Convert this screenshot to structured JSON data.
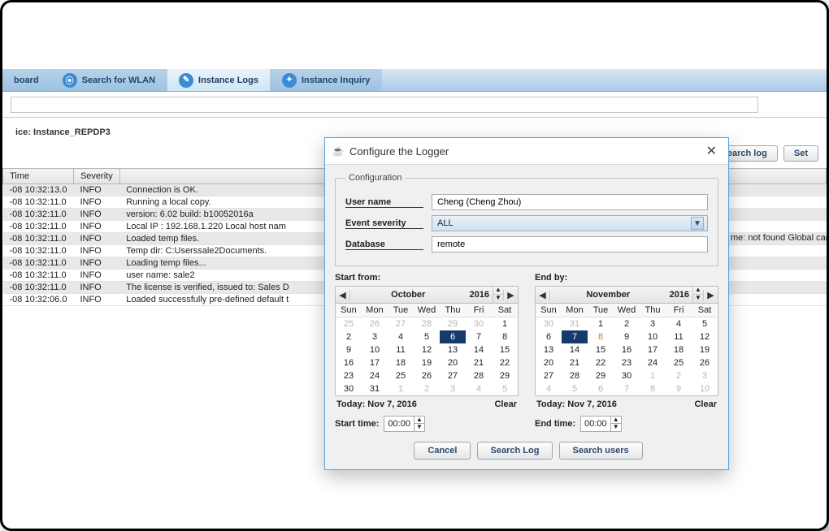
{
  "tabs": [
    {
      "label": "board",
      "icon": "dash"
    },
    {
      "label": "Search for WLAN",
      "icon": "search"
    },
    {
      "label": "Instance Logs",
      "icon": "logs"
    },
    {
      "label": "Instance Inquiry",
      "icon": "inquiry"
    }
  ],
  "active_tab": 2,
  "instance_line": "ice: Instance_REPDP3",
  "buttons": {
    "search_log": "Search log",
    "set": "Set"
  },
  "log_columns": {
    "time": "Time",
    "severity": "Severity",
    "message": ""
  },
  "log_rows": [
    {
      "time": "-08 10:32:13.0",
      "sev": "INFO",
      "msg": "Connection is OK."
    },
    {
      "time": "-08 10:32:11.0",
      "sev": "INFO",
      "msg": "Running a local copy."
    },
    {
      "time": "-08 10:32:11.0",
      "sev": "INFO",
      "msg": "version: 6.02  build: b10052016a"
    },
    {
      "time": "-08 10:32:11.0",
      "sev": "INFO",
      "msg": " Local IP : 192.168.1.220  Local host nam"
    },
    {
      "time": "-08 10:32:11.0",
      "sev": "INFO",
      "msg": "Loaded temp files."
    },
    {
      "time": "-08 10:32:11.0",
      "sev": "INFO",
      "msg": "Temp dir: C:Userssale2Documents."
    },
    {
      "time": "-08 10:32:11.0",
      "sev": "INFO",
      "msg": "Loading temp files..."
    },
    {
      "time": "-08 10:32:11.0",
      "sev": "INFO",
      "msg": "user name: sale2"
    },
    {
      "time": "-08 10:32:11.0",
      "sev": "INFO",
      "msg": "The license is verified, issued to: Sales D"
    },
    {
      "time": "-08 10:32:06.0",
      "sev": "INFO",
      "msg": "Loaded successfully pre-defined default t"
    }
  ],
  "overflow_msg": "me: not found  Global canonical name: not fou",
  "dialog": {
    "title": "Configure the Logger",
    "legend": "Configuration",
    "user_label": "User name",
    "user_value": "Cheng (Cheng Zhou)",
    "event_label": "Event severity",
    "event_value": "ALL",
    "db_label": "Database",
    "db_value": "remote",
    "start_from": "Start from:",
    "end_by": "End by:",
    "start_month": "October",
    "start_year": "2016",
    "end_month": "November",
    "end_year": "2016",
    "dow": [
      "Sun",
      "Mon",
      "Tue",
      "Wed",
      "Thu",
      "Fri",
      "Sat"
    ],
    "start_days": [
      {
        "n": "25",
        "dim": true
      },
      {
        "n": "26",
        "dim": true
      },
      {
        "n": "27",
        "dim": true
      },
      {
        "n": "28",
        "dim": true
      },
      {
        "n": "29",
        "dim": true
      },
      {
        "n": "30",
        "dim": true
      },
      {
        "n": "1"
      },
      {
        "n": "2"
      },
      {
        "n": "3"
      },
      {
        "n": "4"
      },
      {
        "n": "5"
      },
      {
        "n": "6",
        "sel": true
      },
      {
        "n": "7"
      },
      {
        "n": "8"
      },
      {
        "n": "9"
      },
      {
        "n": "10"
      },
      {
        "n": "11"
      },
      {
        "n": "12"
      },
      {
        "n": "13"
      },
      {
        "n": "14"
      },
      {
        "n": "15"
      },
      {
        "n": "16"
      },
      {
        "n": "17"
      },
      {
        "n": "18"
      },
      {
        "n": "19"
      },
      {
        "n": "20"
      },
      {
        "n": "21"
      },
      {
        "n": "22"
      },
      {
        "n": "23"
      },
      {
        "n": "24"
      },
      {
        "n": "25"
      },
      {
        "n": "26"
      },
      {
        "n": "27"
      },
      {
        "n": "28"
      },
      {
        "n": "29"
      },
      {
        "n": "30"
      },
      {
        "n": "31"
      },
      {
        "n": "1",
        "dim": true
      },
      {
        "n": "2",
        "dim": true
      },
      {
        "n": "3",
        "dim": true
      },
      {
        "n": "4",
        "dim": true
      },
      {
        "n": "5",
        "dim": true
      }
    ],
    "end_days": [
      {
        "n": "30",
        "dim": true
      },
      {
        "n": "31",
        "dim": true
      },
      {
        "n": "1"
      },
      {
        "n": "2"
      },
      {
        "n": "3"
      },
      {
        "n": "4"
      },
      {
        "n": "5"
      },
      {
        "n": "6"
      },
      {
        "n": "7",
        "sel": true
      },
      {
        "n": "8",
        "orange": true
      },
      {
        "n": "9"
      },
      {
        "n": "10"
      },
      {
        "n": "11"
      },
      {
        "n": "12"
      },
      {
        "n": "13"
      },
      {
        "n": "14"
      },
      {
        "n": "15"
      },
      {
        "n": "16"
      },
      {
        "n": "17"
      },
      {
        "n": "18"
      },
      {
        "n": "19"
      },
      {
        "n": "20"
      },
      {
        "n": "21"
      },
      {
        "n": "22"
      },
      {
        "n": "23"
      },
      {
        "n": "24"
      },
      {
        "n": "25"
      },
      {
        "n": "26"
      },
      {
        "n": "27"
      },
      {
        "n": "28"
      },
      {
        "n": "29"
      },
      {
        "n": "30"
      },
      {
        "n": "1",
        "dim": true
      },
      {
        "n": "2",
        "dim": true
      },
      {
        "n": "3",
        "dim": true
      },
      {
        "n": "4",
        "dim": true
      },
      {
        "n": "5",
        "dim": true
      },
      {
        "n": "6",
        "dim": true
      },
      {
        "n": "7",
        "dim": true
      },
      {
        "n": "8",
        "dim": true
      },
      {
        "n": "9",
        "dim": true
      },
      {
        "n": "10",
        "dim": true
      }
    ],
    "today": "Today: Nov 7, 2016",
    "clear": "Clear",
    "start_time_label": "Start time:",
    "start_time_value": "00:00",
    "end_time_label": "End time:",
    "end_time_value": "00:00",
    "btn_cancel": "Cancel",
    "btn_search_log": "Search Log",
    "btn_search_users": "Search users"
  }
}
